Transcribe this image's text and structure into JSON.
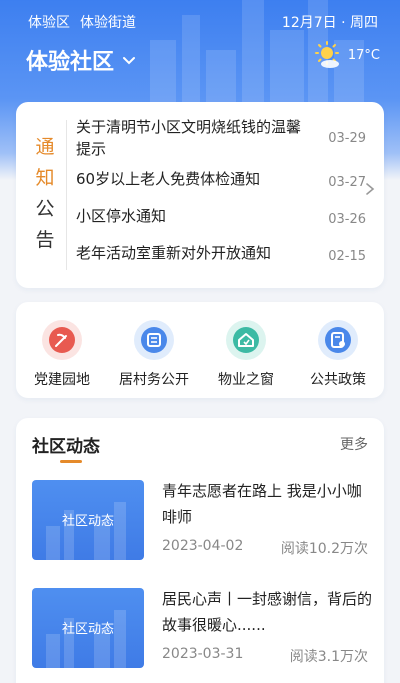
{
  "header": {
    "location_items": [
      "体验区",
      "体验街道"
    ],
    "date": "12月7日 · 周四",
    "community_name": "体验社区",
    "temperature": "17°C",
    "weather_icon": "sun-cloud-icon"
  },
  "notice": {
    "label_chars": [
      "通",
      "知",
      "公",
      "告"
    ],
    "items": [
      {
        "text": "关于清明节小区文明烧纸钱的温馨提示",
        "date": "03-29"
      },
      {
        "text": "60岁以上老人免费体检通知",
        "date": "03-27"
      },
      {
        "text": "小区停水通知",
        "date": "03-26"
      },
      {
        "text": "老年活动室重新对外开放通知",
        "date": "02-15"
      }
    ]
  },
  "services": [
    {
      "label": "党建园地",
      "icon": "party-flag-icon",
      "color": "#e85a50",
      "bg": "#fbe4e2"
    },
    {
      "label": "居村务公开",
      "icon": "notice-board-icon",
      "color": "#4a88ea",
      "bg": "#e0ecfc"
    },
    {
      "label": "物业之窗",
      "icon": "house-icon",
      "color": "#3cbaa4",
      "bg": "#dcf4ef"
    },
    {
      "label": "公共政策",
      "icon": "policy-doc-icon",
      "color": "#4a88ea",
      "bg": "#e0ecfc"
    }
  ],
  "news": {
    "title": "社区动态",
    "more": "更多",
    "thumb_label": "社区动态",
    "items": [
      {
        "title": "青年志愿者在路上 我是小小咖啡师",
        "date": "2023-04-02",
        "reads": "阅读10.2万次"
      },
      {
        "title": "居民心声丨一封感谢信，背后的故事很暖心......",
        "date": "2023-03-31",
        "reads": "阅读3.1万次"
      }
    ]
  },
  "colors": {
    "primary": "#3d7ff0",
    "accent": "#e58a2a"
  }
}
